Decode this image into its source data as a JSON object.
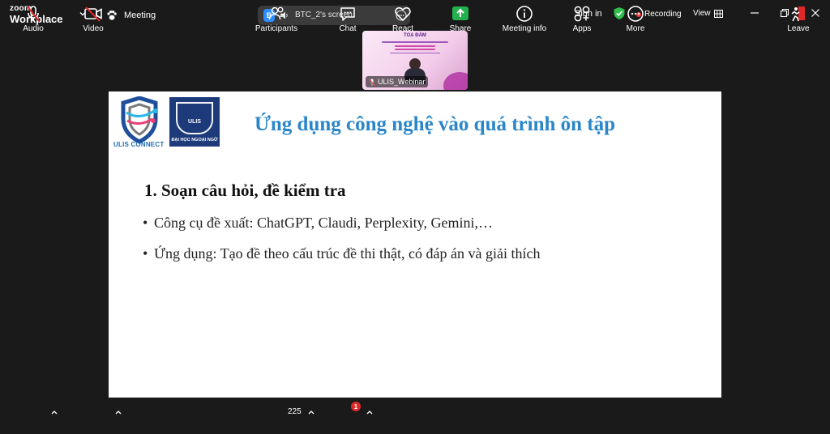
{
  "app": {
    "brand_line1": "zoom",
    "brand_line2": "Workplace"
  },
  "topbar": {
    "meeting_label": "Meeting",
    "share_pill": {
      "avatar_letter": "B",
      "label": "BTC_2's screen"
    },
    "sign_in": "Sign in",
    "recording": "Recording",
    "view": "View",
    "colors": {
      "recording_dot": "#ff3b3b",
      "shield": "#2fbf4a",
      "accent": "#2d8cff"
    }
  },
  "thumbnail": {
    "participant_name": "ULIS_Webinar",
    "slide_title": "TOẠ ĐÀM"
  },
  "slide": {
    "logo1_text": "ULIS CONNECT",
    "logo2_name": "ULIS",
    "logo2_text": "ĐẠI HỌC NGOẠI NGỮ",
    "title": "Ứng dụng công nghệ vào quá trình ôn tập",
    "heading": "1. Soạn câu hỏi, đề kiểm tra",
    "bullets": [
      "Công cụ đề xuất: ChatGPT, Claudi, Perplexity, Gemini,…",
      "Ứng dụng: Tạo đề theo cấu trúc đề thi thật, có đáp án và giải thích"
    ],
    "colors": {
      "title": "#2a86c8"
    }
  },
  "toolbar": {
    "audio": "Audio",
    "video": "Video",
    "participants": "Participants",
    "participants_count": "225",
    "chat": "Chat",
    "chat_badge": "1",
    "react": "React",
    "share": "Share",
    "meeting_info": "Meeting info",
    "apps": "Apps",
    "more": "More",
    "leave": "Leave",
    "colors": {
      "share_green": "#23b14d",
      "leave_red": "#e02828",
      "muted_red": "#e02828"
    }
  }
}
